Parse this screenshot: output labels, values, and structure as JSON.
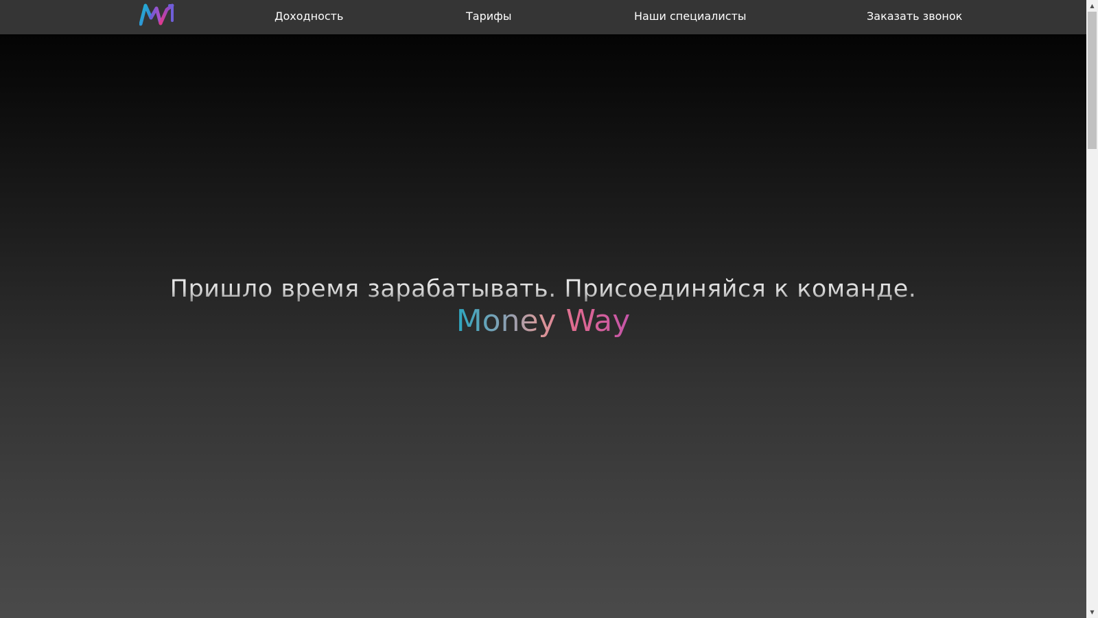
{
  "logo": {
    "alt": "MW",
    "colors": [
      "#27aacd",
      "#7b4fd0",
      "#e2449a"
    ]
  },
  "nav": {
    "items": [
      {
        "label": "Доходность"
      },
      {
        "label": "Тарифы"
      },
      {
        "label": "Наши специалисты"
      },
      {
        "label": "Заказать звонок"
      }
    ]
  },
  "hero": {
    "headline": "Пришло время зарабатывать. Присоединяйся к команде.",
    "brand": "Money Way"
  },
  "colors": {
    "navbar_bg": "#353535",
    "nav_text": "#ffffff",
    "brand_gradient": [
      "#2aa6c0",
      "#d99a9a",
      "#e06a90",
      "#c454a8"
    ],
    "scrollbar_track": "#f1f1f1",
    "scrollbar_thumb": "#c1c1c1"
  }
}
